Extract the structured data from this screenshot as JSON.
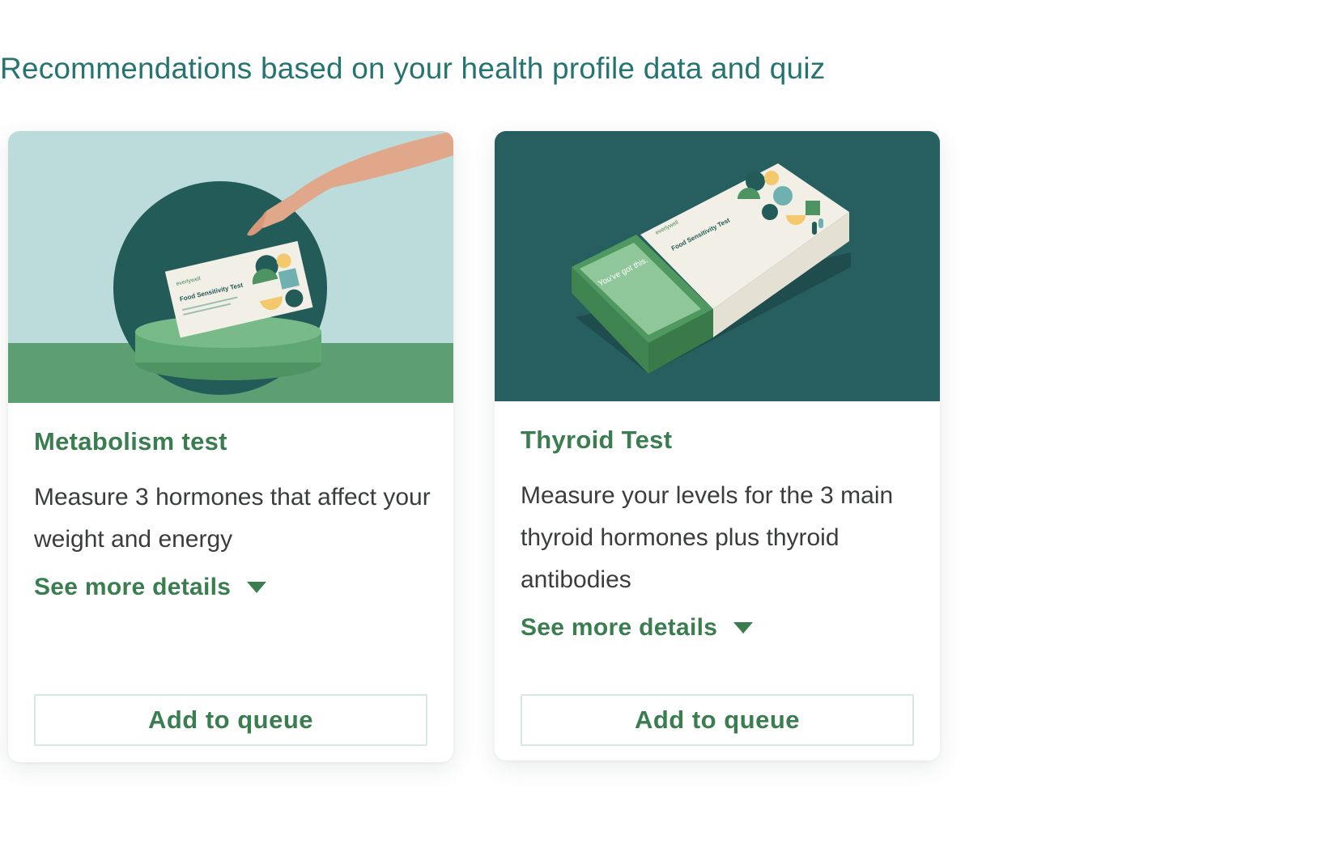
{
  "section": {
    "heading": "Recommendations based on your health profile data and quiz"
  },
  "cards": [
    {
      "title": "Metabolism test",
      "description": "Measure 3 hormones that affect your weight and energy",
      "details_label": "See more details",
      "button_label": "Add to queue",
      "image": {
        "box_brand": "everlywell",
        "box_title": "Food Sensitivity Test",
        "background_color": "#bcdcdc",
        "floor_color": "#5e9e73"
      }
    },
    {
      "title": "Thyroid Test",
      "description": "Measure your levels for the 3 main thyroid hormones plus thyroid antibodies",
      "details_label": "See more details",
      "button_label": "Add to queue",
      "image": {
        "box_brand": "everlywell",
        "box_title": "Food Sensitivity Test",
        "box_tagline": "You've got this.",
        "background_color": "#275e5f"
      }
    }
  ],
  "colors": {
    "heading": "#25746f",
    "accent_green": "#3a7d4f",
    "body_text": "#3b3d3d",
    "button_border": "#d6e8e3"
  }
}
